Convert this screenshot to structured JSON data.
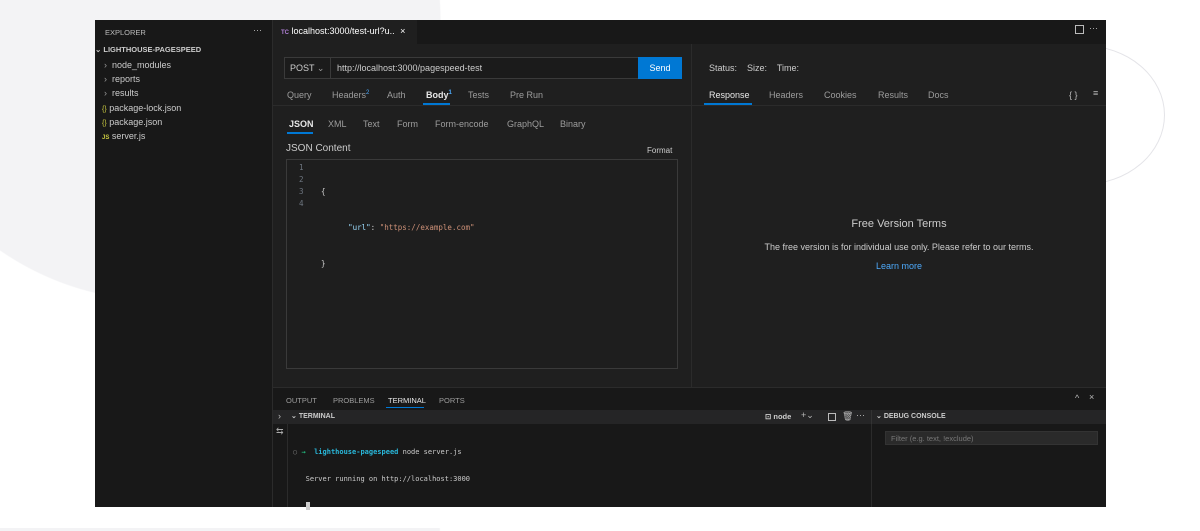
{
  "sidebar": {
    "title": "EXPLORER",
    "more": "···",
    "root": "LIGHTHOUSE-PAGESPEED",
    "items": [
      {
        "label": "node_modules",
        "icon": "›"
      },
      {
        "label": "reports",
        "icon": "›"
      },
      {
        "label": "results",
        "icon": "›"
      },
      {
        "label": "package-lock.json",
        "icon": "{}"
      },
      {
        "label": "package.json",
        "icon": "{}"
      },
      {
        "label": "server.js",
        "icon": "JS"
      }
    ]
  },
  "editor_tab": {
    "icon": "TC",
    "label": "localhost:3000/test-url?u..",
    "close": "×"
  },
  "request": {
    "method": "POST",
    "url": "http://localhost:3000/pagespeed-test",
    "send": "Send",
    "tabs": [
      {
        "label": "Query"
      },
      {
        "label": "Headers",
        "badge": "2"
      },
      {
        "label": "Auth"
      },
      {
        "label": "Body",
        "badge": "1"
      },
      {
        "label": "Tests"
      },
      {
        "label": "Pre Run"
      }
    ],
    "body_tabs": [
      "JSON",
      "XML",
      "Text",
      "Form",
      "Form-encode",
      "GraphQL",
      "Binary"
    ],
    "content_label": "JSON Content",
    "format": "Format",
    "lines": [
      "1",
      "2",
      "3",
      "4"
    ],
    "code": {
      "l1": "{",
      "key": "\"url\"",
      "colon": ": ",
      "value": "\"https://example.com\"",
      "l3": "}"
    }
  },
  "response": {
    "status": "Status:",
    "size": "Size:",
    "time": "Time:",
    "tabs": [
      "Response",
      "Headers",
      "Cookies",
      "Results",
      "Docs"
    ],
    "terms_title": "Free Version Terms",
    "terms_text": "The free version is for individual use only. Please refer to our terms.",
    "learn_more": "Learn more"
  },
  "panel": {
    "tabs": [
      "OUTPUT",
      "PROBLEMS",
      "TERMINAL",
      "PORTS"
    ],
    "terminal_header": "TERMINAL",
    "shell": "node",
    "debug_header": "DEBUG CONSOLE",
    "filter_placeholder": "Filter (e.g. text, !exclude)",
    "term": {
      "arrow": "→",
      "dir": "lighthouse-pagespeed",
      "cmd": "node server.js",
      "out": "Server running on http://localhost:3000"
    }
  },
  "colors": {
    "accent": "#0078d4",
    "string": "#ce9178",
    "key": "#9cdcfe",
    "prompt": "#23d18b"
  }
}
